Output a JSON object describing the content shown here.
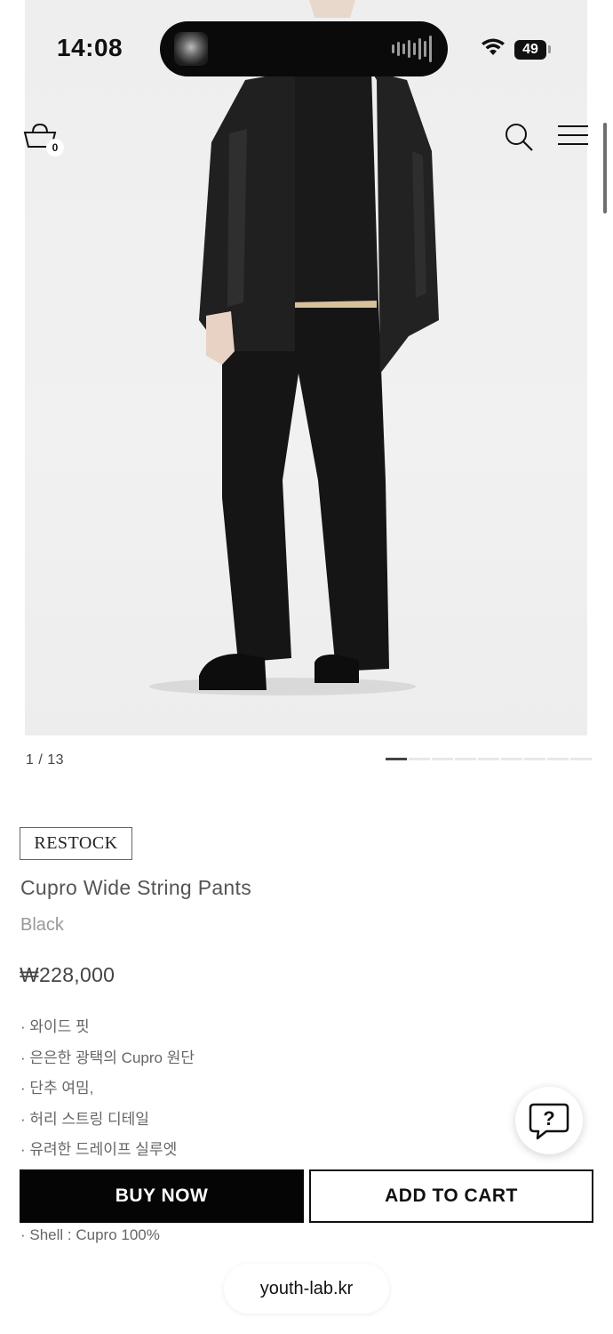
{
  "status_bar": {
    "time": "14:08",
    "battery": "49",
    "wifi_icon": "wifi-icon"
  },
  "header": {
    "cart_count": "0",
    "icons": [
      "cart-icon",
      "search-icon",
      "menu-icon"
    ]
  },
  "gallery": {
    "counter": "1 / 13",
    "current": 1,
    "total": 13,
    "pager_segments": 9
  },
  "product": {
    "badge": "RESTOCK",
    "title": "Cupro Wide String Pants",
    "color": "Black",
    "price": "₩228,000",
    "features": [
      "· 와이드 핏",
      "· 은은한 광택의 Cupro 원단",
      "· 단추 여밈,",
      "· 허리 스트링 디테일",
      "· 유려한 드레이프 실루엣"
    ],
    "spec": "· Shell : Cupro 100%"
  },
  "actions": {
    "buy_now": "BUY NOW",
    "add_to_cart": "ADD TO CART"
  },
  "help": {
    "icon": "question-chat-icon"
  },
  "browser": {
    "url": "youth-lab.kr"
  },
  "colors": {
    "accent": "#050505",
    "background": "#ffffff",
    "hero_background": "#efefef"
  }
}
